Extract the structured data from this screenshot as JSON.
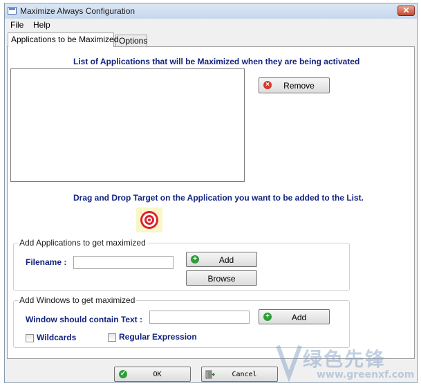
{
  "window": {
    "title": "Maximize Always Configuration",
    "close_symbol": "✕"
  },
  "menu": {
    "items": [
      {
        "label": "File"
      },
      {
        "label": "Help"
      }
    ]
  },
  "tabs": [
    {
      "label": "Applications to be Maximized",
      "selected": true
    },
    {
      "label": "Options",
      "selected": false
    }
  ],
  "main": {
    "list_heading": "List of Applications that will be Maximized when they are being activated",
    "remove_label": "Remove",
    "drag_heading": "Drag and Drop Target on the Application you want to be added to the List.",
    "target_icon": "target-icon"
  },
  "add_apps_group": {
    "title": "Add Applications to get maximized",
    "filename_label": "Filename :",
    "filename_value": "",
    "add_label": "Add",
    "browse_label": "Browse"
  },
  "add_windows_group": {
    "title": "Add Windows to get maximized",
    "window_text_label": "Window should contain Text :",
    "window_text_value": "",
    "add_label": "Add",
    "wildcards_label": "Wildcards",
    "wildcards_checked": false,
    "regex_label": "Regular Expression",
    "regex_checked": false
  },
  "footer": {
    "ok_label": "OK",
    "cancel_label": "Cancel"
  },
  "watermark": {
    "line1": "绿色先锋",
    "line2": "www.greenxf.com"
  },
  "colors": {
    "heading_blue": "#13237e",
    "remove_red": "#d9382a",
    "add_green": "#2e9e3a",
    "target_red": "#e0202a",
    "target_bg": "#fbf6c8"
  }
}
